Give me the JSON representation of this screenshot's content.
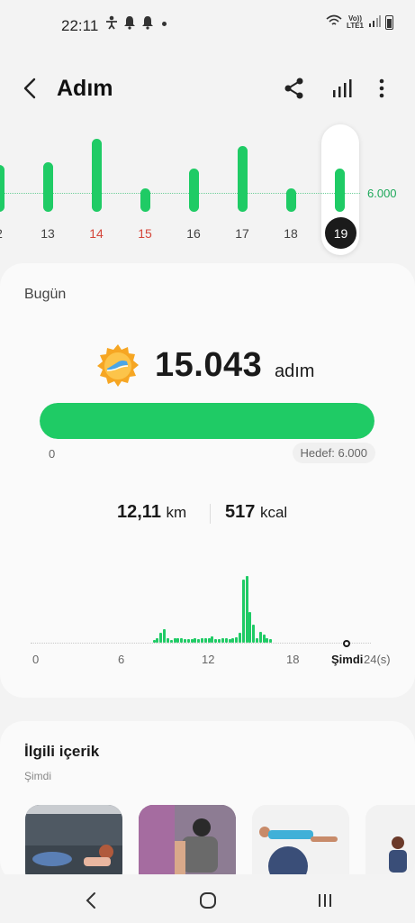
{
  "status": {
    "time": "22:11",
    "lte_top": "Vo))",
    "lte_bottom": "LTE1"
  },
  "header": {
    "title": "Adım",
    "back_icon": "back-arrow-icon",
    "share_icon": "share-icon",
    "chart_icon": "bar-chart-icon",
    "menu_icon": "more-vert-icon"
  },
  "week": {
    "goal_label": "6.000",
    "days": [
      {
        "label": "2",
        "level": 0.4,
        "red": false
      },
      {
        "label": "13",
        "level": 0.42,
        "red": false
      },
      {
        "label": "14",
        "level": 0.62,
        "red": true
      },
      {
        "label": "15",
        "level": 0.2,
        "red": true
      },
      {
        "label": "16",
        "level": 0.37,
        "red": false
      },
      {
        "label": "17",
        "level": 0.56,
        "red": false
      },
      {
        "label": "18",
        "level": 0.2,
        "red": false
      },
      {
        "label": "19",
        "level": 0.37,
        "red": false,
        "selected": true
      }
    ]
  },
  "today": {
    "label": "Bugün",
    "steps": "15.043",
    "unit": "adım",
    "progress": 1.0,
    "progress_min": "0",
    "goal_text": "Hedef: 6.000",
    "distance_value": "12,11",
    "distance_unit": "km",
    "calories_value": "517",
    "calories_unit": "kcal"
  },
  "hourly": {
    "ticks": [
      "0",
      "6",
      "12",
      "18"
    ],
    "now_label": "Şimdi",
    "end_label": "24(s)",
    "bars": [
      0,
      0,
      0,
      0,
      0,
      0,
      0,
      0,
      0,
      0,
      0,
      0,
      0,
      0,
      0,
      0,
      0,
      0,
      0,
      0,
      0,
      0,
      0,
      0,
      0,
      0,
      0,
      0,
      0,
      0,
      0,
      0,
      0,
      0,
      0.03,
      0.05,
      0.12,
      0.17,
      0.05,
      0.03,
      0.05,
      0.05,
      0.05,
      0.04,
      0.04,
      0.04,
      0.05,
      0.04,
      0.05,
      0.06,
      0.06,
      0.08,
      0.04,
      0.04,
      0.05,
      0.05,
      0.04,
      0.05,
      0.07,
      0.12,
      0.78,
      0.82,
      0.38,
      0.22,
      0.06,
      0.13,
      0.1,
      0.05,
      0.04,
      0,
      0,
      0,
      0,
      0,
      0,
      0,
      0,
      0,
      0,
      0,
      0,
      0,
      0,
      0,
      0,
      0,
      0,
      0,
      0,
      0,
      0,
      0,
      0,
      0,
      0,
      0
    ]
  },
  "related": {
    "title": "İlgili içerik",
    "subtitle": "Şimdi"
  },
  "nav": {
    "back_icon": "nav-back-icon",
    "home_icon": "nav-home-icon",
    "recents_icon": "nav-recents-icon"
  }
}
